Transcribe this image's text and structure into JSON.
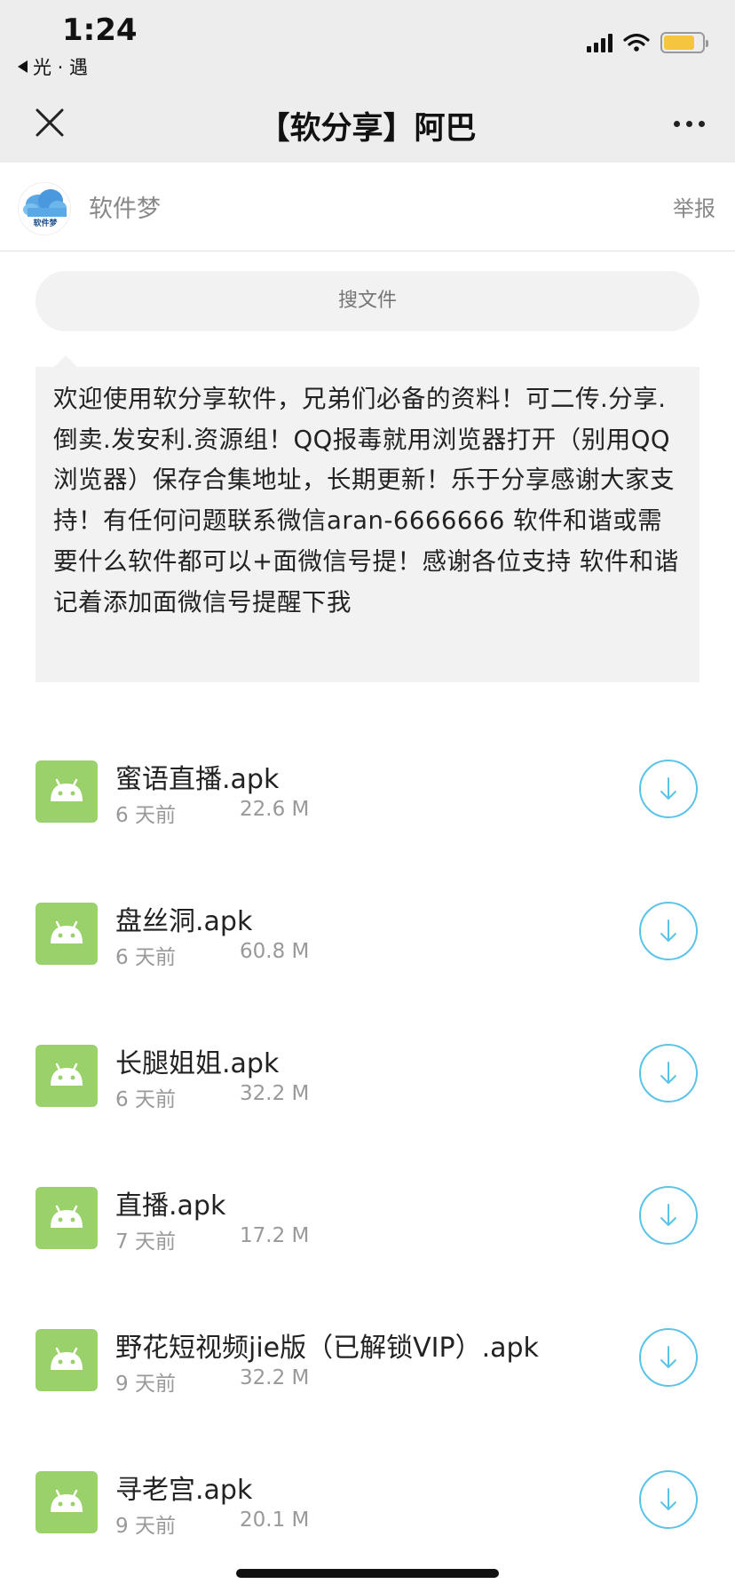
{
  "status_bar": {
    "time": "1:24",
    "back_app": "光 · 遇"
  },
  "nav": {
    "title": "【软分享】阿巴"
  },
  "account": {
    "name": "软件梦",
    "report_label": "举报",
    "avatar_text": "软件梦"
  },
  "search": {
    "placeholder": "搜文件"
  },
  "description": "欢迎使用软分享软件，兄弟们必备的资料！可二传.分享.倒卖.发安利.资源组！QQ报毒就用浏览器打开（别用QQ浏览器）保存合集地址，长期更新！乐于分享感谢大家支持！有任何问题联系微信aran-6666666 软件和谐或需要什么软件都可以+面微信号提！感谢各位支持 软件和谐记着添加面微信号提醒下我",
  "files": [
    {
      "name": "蜜语直播.apk",
      "date": "6 天前",
      "size": "22.6 M"
    },
    {
      "name": "盘丝洞.apk",
      "date": "6 天前",
      "size": "60.8 M"
    },
    {
      "name": "长腿姐姐.apk",
      "date": "6 天前",
      "size": "32.2 M"
    },
    {
      "name": "直播.apk",
      "date": "7 天前",
      "size": "17.2 M"
    },
    {
      "name": "野花短视频jie版（已解锁VIP）.apk",
      "date": "9 天前",
      "size": "32.2 M"
    },
    {
      "name": "寻老宫.apk",
      "date": "9 天前",
      "size": "20.1 M"
    }
  ],
  "colors": {
    "header_bg": "#ededed",
    "apk_icon": "#9bd16b",
    "download_accent": "#5bc3e8",
    "battery": "#f5c53f"
  },
  "icons": {
    "close": "close-icon",
    "more": "more-dots-icon",
    "file": "android-icon",
    "download": "download-icon"
  }
}
